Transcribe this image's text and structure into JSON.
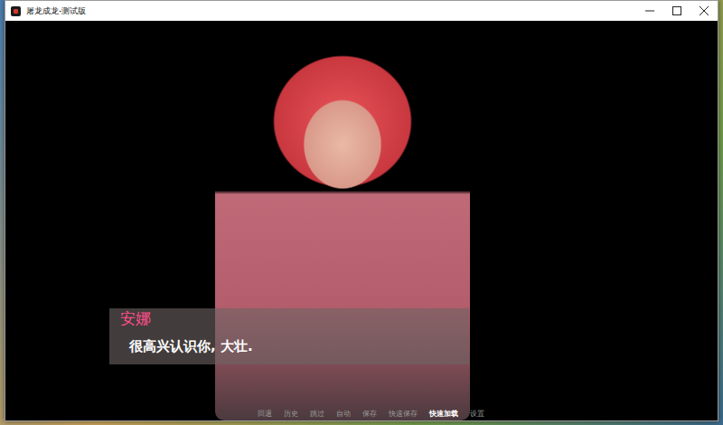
{
  "window": {
    "title": "屠龙成龙-测试版"
  },
  "dialogue": {
    "speaker": "安娜",
    "line": "很高兴认识你, 大壮."
  },
  "quick_menu": [
    {
      "label": "回退",
      "selected": false
    },
    {
      "label": "历史",
      "selected": false
    },
    {
      "label": "跳过",
      "selected": false
    },
    {
      "label": "自动",
      "selected": false
    },
    {
      "label": "保存",
      "selected": false
    },
    {
      "label": "快速保存",
      "selected": false
    },
    {
      "label": "快速加载",
      "selected": true
    },
    {
      "label": "设置",
      "selected": false
    }
  ]
}
